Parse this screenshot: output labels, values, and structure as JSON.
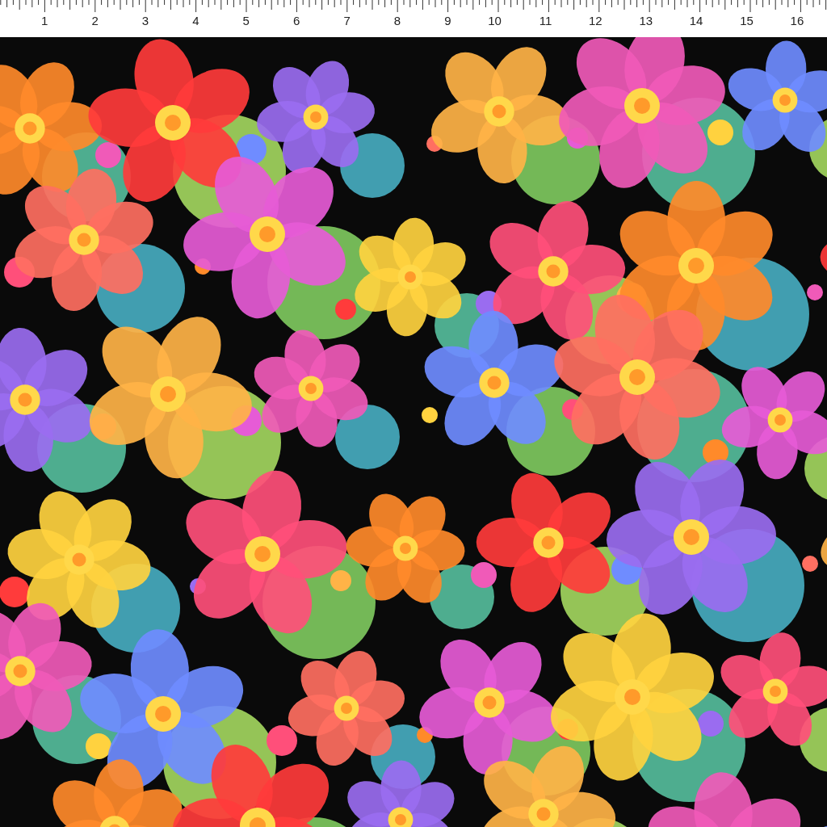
{
  "ruler": {
    "marks": [
      "1",
      "2",
      "3",
      "4",
      "5",
      "6",
      "7",
      "8",
      "9",
      "10",
      "11",
      "12",
      "13",
      "14",
      "15",
      "16"
    ]
  }
}
